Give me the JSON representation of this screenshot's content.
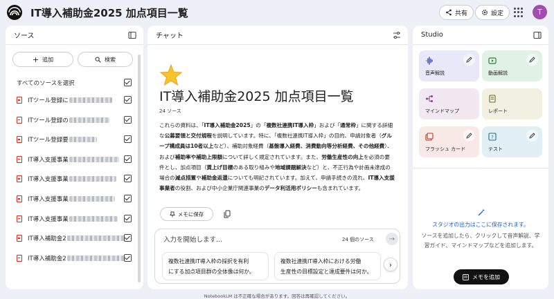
{
  "app": {
    "title": "IT導入補助金2025 加点項目一覧",
    "avatar_letter": "T",
    "avatar_color": "#a24bb0"
  },
  "header": {
    "share_label": "共有",
    "settings_label": "設定"
  },
  "sources": {
    "title": "ソース",
    "add_label": "追加",
    "search_label": "検索",
    "select_all_label": "すべてのソースを選択",
    "items": [
      {
        "label": "ITツール登録に"
      },
      {
        "label": "ITツール登録の"
      },
      {
        "label": "ITツール登録要"
      },
      {
        "label": "IT導入支援事業"
      },
      {
        "label": "IT導入支援事業"
      },
      {
        "label": "IT導入支援事業"
      },
      {
        "label": "IT導入支援事業"
      },
      {
        "label": "IT導入補助金2"
      },
      {
        "label": "IT導入補助金2"
      }
    ]
  },
  "chat": {
    "title": "チャット",
    "notebook_title": "IT導入補助金2025 加点項目一覧",
    "source_count": "24 ソース",
    "summary": [
      {
        "t": "これらの資料は、「"
      },
      {
        "t": "IT導入補助金2025",
        "b": true
      },
      {
        "t": "」の「"
      },
      {
        "t": "複数社連携IT導入枠",
        "b": true
      },
      {
        "t": "」および「"
      },
      {
        "t": "通常枠",
        "b": true
      },
      {
        "t": "」に関する詳細な"
      },
      {
        "t": "公募要領と交付規程",
        "b": true
      },
      {
        "t": "を説明しています。特に、「複数社連携IT導入枠」の目的、申請対象者（"
      },
      {
        "t": "グループ構成員は10者以上",
        "b": true
      },
      {
        "t": "など）、補助対象経費（"
      },
      {
        "t": "基盤導入経費、消費動向等分析経費、その他経費",
        "b": true
      },
      {
        "t": "）、および"
      },
      {
        "t": "補助率や補助上限額",
        "b": true
      },
      {
        "t": "について詳しく規定されています。また、"
      },
      {
        "t": "労働生産性の向上",
        "b": true
      },
      {
        "t": "を必須の要件とし、加点項目（"
      },
      {
        "t": "賃上げ目標",
        "b": true
      },
      {
        "t": "のある取り組みや"
      },
      {
        "t": "地域課題解決",
        "b": true
      },
      {
        "t": "など）と、不正行為や計画未達成の場合の"
      },
      {
        "t": "減点措置",
        "b": true
      },
      {
        "t": "や"
      },
      {
        "t": "補助金返還",
        "b": true
      },
      {
        "t": "についても明記されています。加えて、申請手続きの流れ、"
      },
      {
        "t": "IT導入支援事業者",
        "b": true
      },
      {
        "t": "の役割、および中小企業庁関連事業の"
      },
      {
        "t": "データ利活用ポリシー",
        "b": true
      },
      {
        "t": "も含まれています。"
      }
    ],
    "save_memo_label": "メモに保存",
    "input_placeholder": "入力を開始します...",
    "input_source_count": "24 個のソース",
    "suggestions": [
      {
        "line1": "複数社連携IT導入枠の採択を有利",
        "line2": "にする加点項目群の全体像は何か。"
      },
      {
        "line1": "複数社連携IT導入枠における労働",
        "line2": "生産性の目標設定と達成要件は何か。"
      }
    ]
  },
  "studio": {
    "title": "Studio",
    "tiles": [
      {
        "label": "音声解説",
        "color": "#e7e9f9",
        "icon": "audio-waveform-icon",
        "editable": true
      },
      {
        "label": "動画解説",
        "color": "#e2f1e5",
        "icon": "video-icon",
        "editable": true
      },
      {
        "label": "マインドマップ",
        "color": "#f1e8f2",
        "icon": "mindmap-icon",
        "editable": false
      },
      {
        "label": "レポート",
        "color": "#f2f0e0",
        "icon": "report-icon",
        "editable": false
      },
      {
        "label": "フラッシュ カード",
        "color": "#f8e9e7",
        "icon": "flashcard-icon",
        "editable": true
      },
      {
        "label": "テスト",
        "color": "#e2f0f6",
        "icon": "quiz-icon",
        "editable": true
      }
    ],
    "saved_text": "スタジオの出力はここに保存されます。",
    "desc_text": "ソースを追加したら、クリックして音声解説、学習ガイド、マインドマップなどを追加します。",
    "add_memo_label": "メモを追加"
  },
  "footer": {
    "text": "NotebookLM は不正確な場合があります。回答は再確認してください。"
  }
}
